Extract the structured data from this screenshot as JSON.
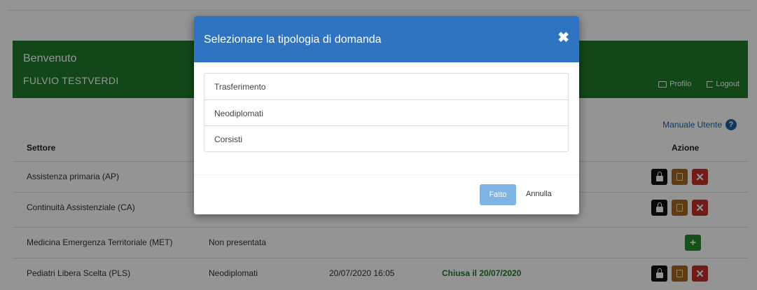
{
  "header": {
    "welcome": "Benvenuto",
    "username": "FULVIO TESTVERDI",
    "profile_label": "Profilo",
    "logout_label": "Logout"
  },
  "manual_label": "Manuale Utente",
  "table": {
    "headers": {
      "sector": "Settore",
      "action": "Azione"
    },
    "rows": [
      {
        "sector": "Assistenza primaria (AP)",
        "type": "",
        "date": "",
        "status": ""
      },
      {
        "sector": "Continuità Assistenziale (CA)",
        "type": "",
        "date": "",
        "status": ""
      },
      {
        "sector": "Medicina Emergenza Territoriale (MET)",
        "type": "Non presentata",
        "date": "",
        "status": ""
      },
      {
        "sector": "Pediatri Libera Scelta (PLS)",
        "type": "Neodiplomati",
        "date": "20/07/2020 16:05",
        "status": "Chiusa il 20/07/2020"
      }
    ]
  },
  "modal": {
    "title": "Selezionare la tipologia di domanda",
    "close_glyph": "✖",
    "options": [
      "Trasferimento",
      "Neodiplomati",
      "Corsisti"
    ],
    "ok_label": "Fatto",
    "cancel_label": "Annulla"
  },
  "colors": {
    "banner": "#1f7a2c",
    "modal_header": "#2f74c0",
    "ok_button": "#7fb2e5",
    "delete": "#c9302c",
    "document": "#a8661f",
    "add": "#2a8a2f"
  }
}
